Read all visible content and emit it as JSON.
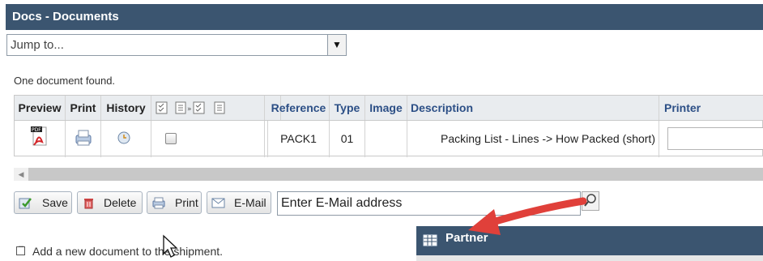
{
  "window": {
    "title": "Docs - Documents"
  },
  "jump": {
    "value": "Jump to..."
  },
  "status": {
    "found": "One document found."
  },
  "table": {
    "headers": {
      "preview": "Preview",
      "print": "Print",
      "history": "History",
      "reference": "Reference",
      "type": "Type",
      "image": "Image",
      "description": "Description",
      "printer": "Printer"
    },
    "rows": [
      {
        "reference": "PACK1",
        "type": "01",
        "image": "",
        "description": "Packing List - Lines -> How Packed (short)",
        "printer": ""
      }
    ]
  },
  "toolbar": {
    "save": "Save",
    "delete": "Delete",
    "print": "Print",
    "email": "E-Mail",
    "email_placeholder": "Enter E-Mail address"
  },
  "footer": {
    "add_new": "Add a new document to the shipment."
  },
  "partner": {
    "title": "Partner"
  },
  "colors": {
    "titlebar": "#3b5570",
    "header_link": "#2c4f86",
    "arrow": "#e0403a"
  },
  "icons": [
    "chevron-down-icon",
    "pdf-icon",
    "printer-icon",
    "history-clock-icon",
    "checkbox-icon",
    "select-all-icon",
    "copy-select-icon",
    "form-icon",
    "save-icon",
    "trash-icon",
    "print-icon",
    "email-icon",
    "magnifier-icon",
    "grid-icon",
    "minus-box-icon",
    "mouse-cursor-icon",
    "red-arrow-icon"
  ]
}
